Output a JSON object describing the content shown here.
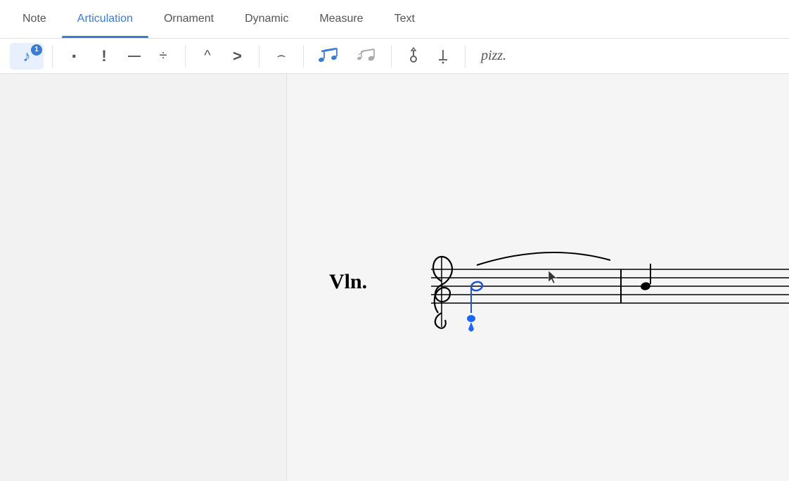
{
  "tabs": [
    {
      "id": "note",
      "label": "Note",
      "active": false
    },
    {
      "id": "articulation",
      "label": "Articulation",
      "active": true
    },
    {
      "id": "ornament",
      "label": "Ornament",
      "active": false
    },
    {
      "id": "dynamic",
      "label": "Dynamic",
      "active": false
    },
    {
      "id": "measure",
      "label": "Measure",
      "active": false
    },
    {
      "id": "text",
      "label": "Text",
      "active": false
    }
  ],
  "toolbar": {
    "note_icon": "♪",
    "note_badge": "1",
    "staccato": "·",
    "staccatissimo": "!",
    "tenuto": "—",
    "portato": "÷",
    "marcato": "^",
    "accent": ">",
    "fermata": "𝄐",
    "slur_notes": "♩♩",
    "grace_notes": "♩",
    "snap_pizzicato": "ʼ",
    "left_hand_pizzicato": "⌐",
    "pizz_text": "pizz."
  },
  "score": {
    "instrument_label": "Vln.",
    "colors": {
      "accent": "#3a7bd5",
      "note_selected": "#2255cc",
      "drop_indicator": "#1a66ff"
    }
  }
}
